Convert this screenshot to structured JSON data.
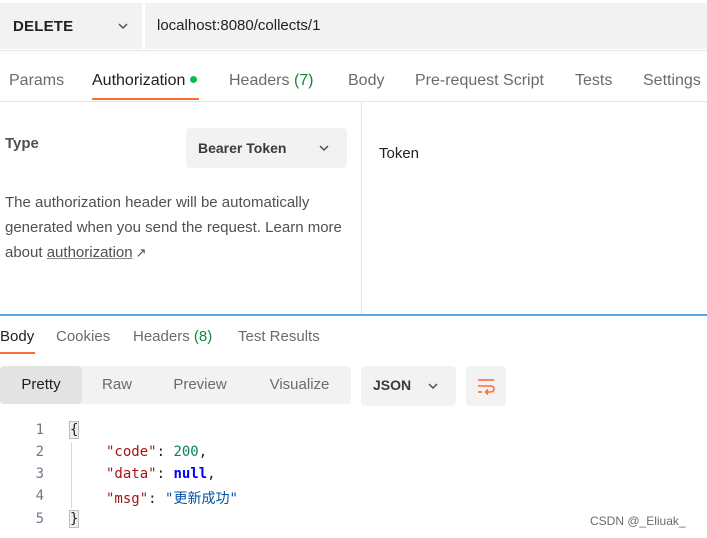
{
  "request": {
    "method": "DELETE",
    "url": "localhost:8080/collects/1"
  },
  "request_tabs": [
    {
      "label": "Params"
    },
    {
      "label": "Authorization"
    },
    {
      "label": "Headers",
      "count": "(7)"
    },
    {
      "label": "Body"
    },
    {
      "label": "Pre-request Script"
    },
    {
      "label": "Tests"
    },
    {
      "label": "Settings"
    }
  ],
  "auth": {
    "type_label": "Type",
    "type_value": "Bearer Token",
    "description": "The authorization header will be automatically generated when you send the request. Learn more about",
    "link_text": "authorization",
    "link_arrow": "↗",
    "token_label": "Token"
  },
  "response_tabs": [
    {
      "label": "Body"
    },
    {
      "label": "Cookies"
    },
    {
      "label": "Headers",
      "count": "(8)"
    },
    {
      "label": "Test Results"
    }
  ],
  "format_buttons": [
    "Pretty",
    "Raw",
    "Preview",
    "Visualize"
  ],
  "format_select": "JSON",
  "code": {
    "line_numbers": [
      "1",
      "2",
      "3",
      "4",
      "5"
    ],
    "open_brace": "{",
    "close_brace": "}",
    "key_code": "\"code\"",
    "val_code": "200",
    "key_data": "\"data\"",
    "val_data": "null",
    "key_msg": "\"msg\"",
    "val_msg": "\"更新成功\""
  },
  "watermark": "CSDN @_Eliuak_",
  "colors": {
    "accent_orange": "#ff6c37",
    "status_green": "#0cbb52",
    "divider_blue": "#5aa6e8"
  },
  "icons": {
    "method_dropdown": "chevron-down-icon",
    "auth_type_dropdown": "chevron-down-icon",
    "format_dropdown": "chevron-down-icon",
    "wrap": "wrap-lines-icon",
    "external_link": "arrow-up-right-icon"
  }
}
